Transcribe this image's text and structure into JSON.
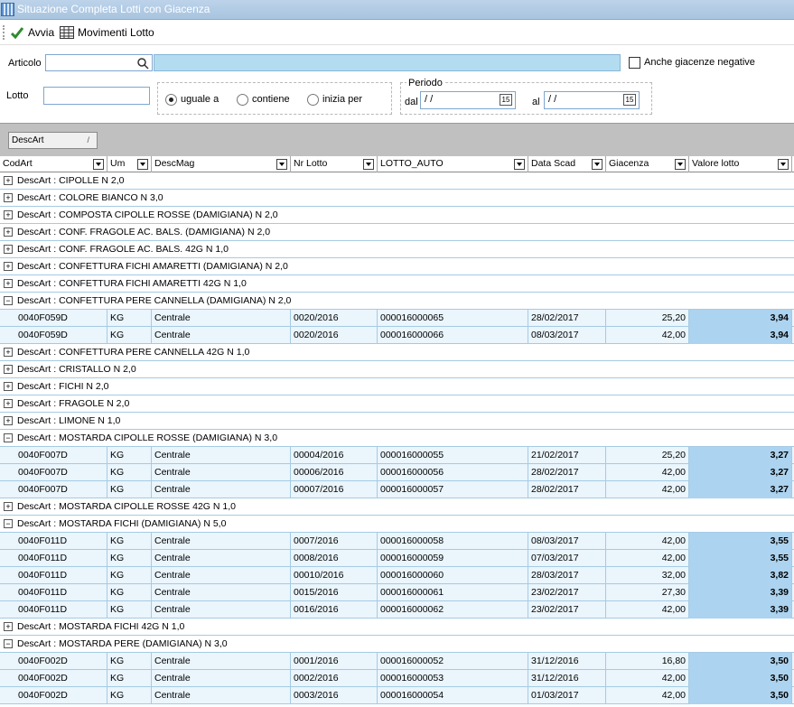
{
  "window": {
    "title": "Situazione Completa Lotti con Giacenza"
  },
  "toolbar": {
    "run_label": "Avvia",
    "movements_label": "Movimenti Lotto"
  },
  "filters": {
    "articolo_label": "Articolo",
    "articolo_value": "",
    "anche_negative_label": "Anche giacenze negative",
    "lotto_label": "Lotto",
    "lotto_value": "",
    "radio_uguale": "uguale a",
    "radio_contiene": "contiene",
    "radio_inizia": "inizia per",
    "selected_mode": "uguale a",
    "periodo_label": "Periodo",
    "dal_label": "dal",
    "dal_value": "/ /",
    "al_label": "al",
    "al_value": "/ /",
    "calendar_glyph": "15"
  },
  "grid": {
    "group_by_chip": "DescArt",
    "group_prefix": "DescArt : ",
    "columns": [
      {
        "key": "codart",
        "label": "CodArt"
      },
      {
        "key": "um",
        "label": "Um"
      },
      {
        "key": "descmag",
        "label": "DescMag"
      },
      {
        "key": "nrlotto",
        "label": "Nr Lotto"
      },
      {
        "key": "lotto_auto",
        "label": "LOTTO_AUTO"
      },
      {
        "key": "datascad",
        "label": "Data Scad"
      },
      {
        "key": "giacenza",
        "label": "Giacenza"
      },
      {
        "key": "valore",
        "label": "Valore lotto"
      }
    ],
    "groups": [
      {
        "name": "CIPOLLE N 2,0",
        "expanded": false,
        "rows": []
      },
      {
        "name": "COLORE BIANCO N 3,0",
        "expanded": false,
        "rows": []
      },
      {
        "name": "COMPOSTA CIPOLLE ROSSE  (DAMIGIANA) N 2,0",
        "expanded": false,
        "rows": []
      },
      {
        "name": "CONF. FRAGOLE AC. BALS. (DAMIGIANA) N 2,0",
        "expanded": false,
        "rows": []
      },
      {
        "name": "CONF. FRAGOLE AC. BALS. 42G N 1,0",
        "expanded": false,
        "rows": []
      },
      {
        "name": "CONFETTURA FICHI AMARETTI (DAMIGIANA) N 2,0",
        "expanded": false,
        "rows": []
      },
      {
        "name": "CONFETTURA FICHI AMARETTI 42G N 1,0",
        "expanded": false,
        "rows": []
      },
      {
        "name": "CONFETTURA PERE CANNELLA (DAMIGIANA) N 2,0",
        "expanded": true,
        "rows": [
          [
            "0040F059D",
            "KG",
            "Centrale",
            "0020/2016",
            "000016000065",
            "28/02/2017",
            "25,20",
            "3,94"
          ],
          [
            "0040F059D",
            "KG",
            "Centrale",
            "0020/2016",
            "000016000066",
            "08/03/2017",
            "42,00",
            "3,94"
          ]
        ]
      },
      {
        "name": "CONFETTURA PERE CANNELLA 42G N 1,0",
        "expanded": false,
        "rows": []
      },
      {
        "name": "CRISTALLO N 2,0",
        "expanded": false,
        "rows": []
      },
      {
        "name": "FICHI N 2,0",
        "expanded": false,
        "rows": []
      },
      {
        "name": "FRAGOLE N 2,0",
        "expanded": false,
        "rows": []
      },
      {
        "name": "LIMONE N 1,0",
        "expanded": false,
        "rows": []
      },
      {
        "name": "MOSTARDA CIPOLLE ROSSE  (DAMIGIANA) N 3,0",
        "expanded": true,
        "rows": [
          [
            "0040F007D",
            "KG",
            "Centrale",
            "00004/2016",
            "000016000055",
            "21/02/2017",
            "25,20",
            "3,27"
          ],
          [
            "0040F007D",
            "KG",
            "Centrale",
            "00006/2016",
            "000016000056",
            "28/02/2017",
            "42,00",
            "3,27"
          ],
          [
            "0040F007D",
            "KG",
            "Centrale",
            "00007/2016",
            "000016000057",
            "28/02/2017",
            "42,00",
            "3,27"
          ]
        ]
      },
      {
        "name": "MOSTARDA CIPOLLE ROSSE 42G N 1,0",
        "expanded": false,
        "rows": []
      },
      {
        "name": "MOSTARDA FICHI (DAMIGIANA) N 5,0",
        "expanded": true,
        "rows": [
          [
            "0040F011D",
            "KG",
            "Centrale",
            "0007/2016",
            "000016000058",
            "08/03/2017",
            "42,00",
            "3,55"
          ],
          [
            "0040F011D",
            "KG",
            "Centrale",
            "0008/2016",
            "000016000059",
            "07/03/2017",
            "42,00",
            "3,55"
          ],
          [
            "0040F011D",
            "KG",
            "Centrale",
            "00010/2016",
            "000016000060",
            "28/03/2017",
            "32,00",
            "3,82"
          ],
          [
            "0040F011D",
            "KG",
            "Centrale",
            "0015/2016",
            "000016000061",
            "23/02/2017",
            "27,30",
            "3,39"
          ],
          [
            "0040F011D",
            "KG",
            "Centrale",
            "0016/2016",
            "000016000062",
            "23/02/2017",
            "42,00",
            "3,39"
          ]
        ]
      },
      {
        "name": "MOSTARDA FICHI 42G N 1,0",
        "expanded": false,
        "rows": []
      },
      {
        "name": "MOSTARDA PERE (DAMIGIANA) N 3,0",
        "expanded": true,
        "rows": [
          [
            "0040F002D",
            "KG",
            "Centrale",
            "0001/2016",
            "000016000052",
            "31/12/2016",
            "16,80",
            "3,50"
          ],
          [
            "0040F002D",
            "KG",
            "Centrale",
            "0002/2016",
            "000016000053",
            "31/12/2016",
            "42,00",
            "3,50"
          ],
          [
            "0040F002D",
            "KG",
            "Centrale",
            "0003/2016",
            "000016000054",
            "01/03/2017",
            "42,00",
            "3,50"
          ]
        ]
      }
    ]
  }
}
